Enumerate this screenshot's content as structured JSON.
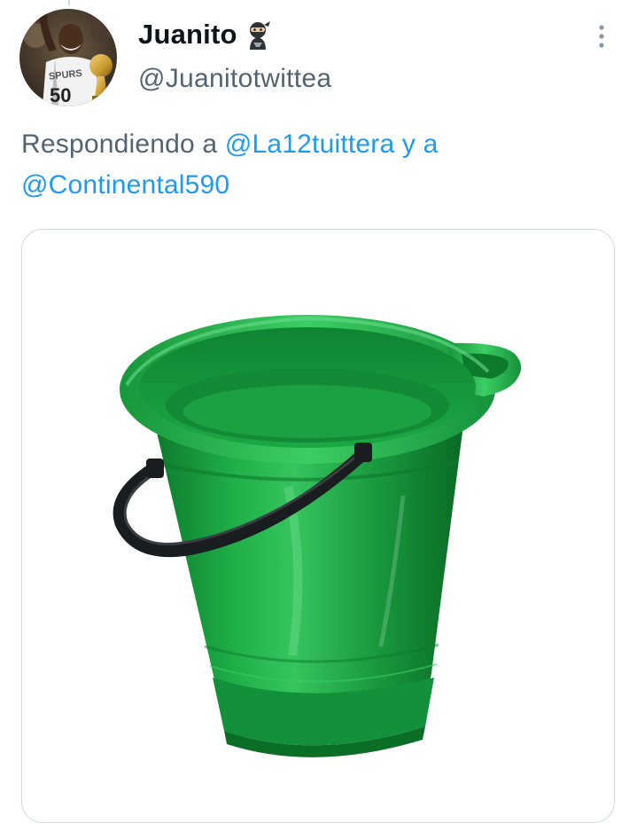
{
  "tweet": {
    "author": {
      "display_name": "Juanito",
      "handle": "@Juanitotwittea",
      "avatar_jersey_text": "SPURS",
      "avatar_number": "50",
      "name_emoji": "ninja-icon"
    },
    "reply_context": {
      "prefix": "Respondiendo a ",
      "mention_1": "@La12tuittera",
      "connector": " y a",
      "mention_2": "@Continental590"
    },
    "media": {
      "type": "image",
      "subject": "green-bucket-image"
    },
    "more_icon": "more-vertical-icon"
  },
  "colors": {
    "link": "#1d9bf0",
    "secondary_text": "#536471",
    "primary_text": "#0f1419",
    "border": "#cfd9de",
    "bucket_green": "#18a03e"
  }
}
